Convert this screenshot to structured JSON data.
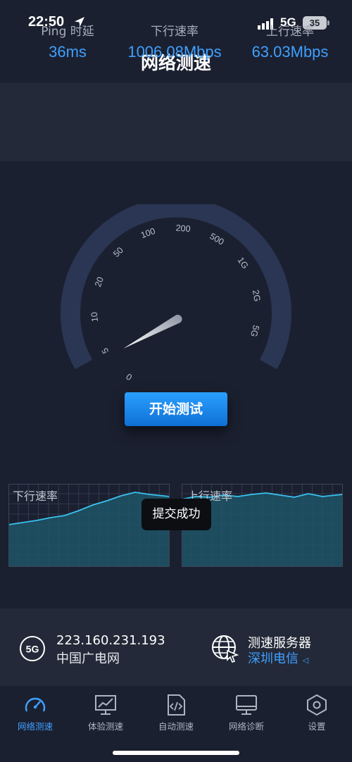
{
  "status_bar": {
    "time": "22:50",
    "network": "5G",
    "battery": "35"
  },
  "title": "网络测速",
  "metrics": [
    {
      "label": "Ping 时延",
      "value": "36ms"
    },
    {
      "label": "下行速率",
      "value": "1006.08Mbps"
    },
    {
      "label": "上行速率",
      "value": "63.03Mbps"
    }
  ],
  "gauge": {
    "ticks": [
      "0",
      "5",
      "10",
      "20",
      "50",
      "100",
      "200",
      "500",
      "1G",
      "2G",
      "5G"
    ]
  },
  "start_button": "开始测试",
  "charts": {
    "download_label": "下行速率",
    "upload_label": "上行速率"
  },
  "toast": "提交成功",
  "info": {
    "ip": "223.160.231.193",
    "isp": "中国广电网",
    "badge": "5G",
    "server_title": "测速服务器",
    "server_name": "深圳电信"
  },
  "tabs": [
    {
      "label": "网络测速",
      "icon": "speedometer-icon",
      "active": true
    },
    {
      "label": "体验测速",
      "icon": "monitor-chart-icon",
      "active": false
    },
    {
      "label": "自动测速",
      "icon": "code-file-icon",
      "active": false
    },
    {
      "label": "网络诊断",
      "icon": "monitor-icon",
      "active": false
    },
    {
      "label": "设置",
      "icon": "settings-hexagon-icon",
      "active": false
    }
  ],
  "colors": {
    "accent": "#3fa0ff",
    "background": "#1b2030",
    "panel": "#232938",
    "gauge_track": "#2b3654"
  }
}
